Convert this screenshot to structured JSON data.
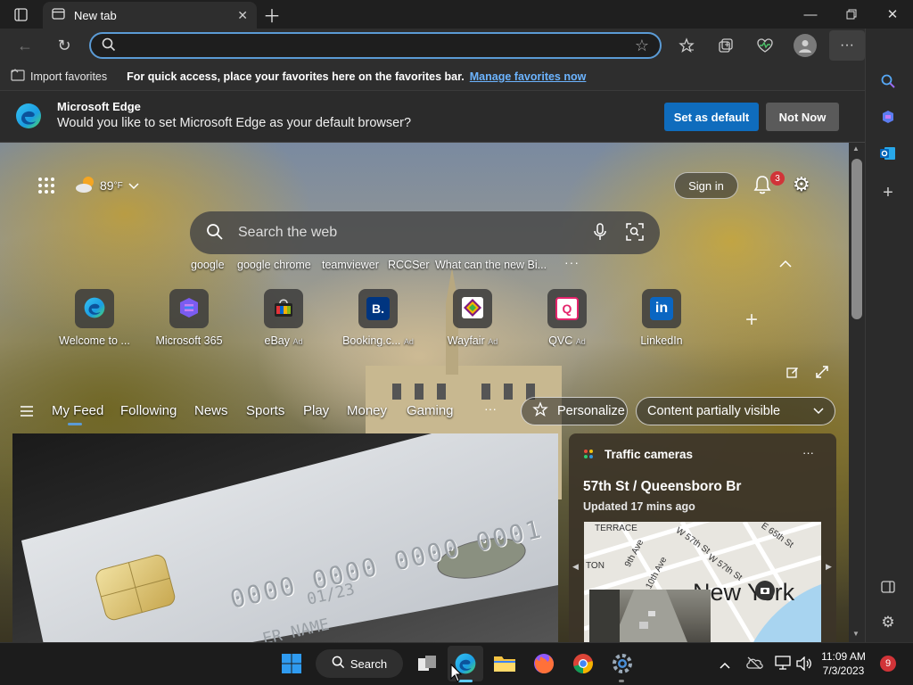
{
  "tab": {
    "title": "New tab"
  },
  "address": {
    "value": "",
    "placeholder": ""
  },
  "favorites_bar": {
    "import_label": "Import favorites",
    "hint": "For quick access, place your favorites here on the favorites bar.",
    "manage_link": "Manage favorites now"
  },
  "infobar": {
    "title": "Microsoft Edge",
    "message": "Would you like to set Microsoft Edge as your default browser?",
    "primary_button": "Set as default",
    "secondary_button": "Not Now"
  },
  "ntp": {
    "weather": "89",
    "weather_unit": "°F",
    "sign_in": "Sign in",
    "notification_count": "3",
    "search_placeholder": "Search the web",
    "suggestions": [
      "google",
      "google chrome",
      "teamviewer",
      "RCCSer",
      "What can the new Bi..."
    ],
    "quick_links": [
      {
        "label": "Welcome to ...",
        "ad": "",
        "icon": "edge-icon"
      },
      {
        "label": "Microsoft 365",
        "ad": "",
        "icon": "microsoft365-icon"
      },
      {
        "label": "eBay",
        "ad": "Ad",
        "icon": "ebay-icon"
      },
      {
        "label": "Booking.c...",
        "ad": "Ad",
        "icon": "booking-icon",
        "glyph": "B."
      },
      {
        "label": "Wayfair",
        "ad": "Ad",
        "icon": "wayfair-icon"
      },
      {
        "label": "QVC",
        "ad": "Ad",
        "icon": "qvc-icon",
        "glyph": "Q"
      },
      {
        "label": "LinkedIn",
        "ad": "",
        "icon": "linkedin-icon",
        "glyph": "in"
      }
    ],
    "feed_tabs": [
      "My Feed",
      "Following",
      "News",
      "Sports",
      "Play",
      "Money",
      "Gaming"
    ],
    "personalize": "Personalize",
    "content_visibility": "Content partially visible",
    "card_number": "0000 0000 0000 0001",
    "card_expiry": "01/23",
    "card_name": "ER NAME",
    "traffic": {
      "header": "Traffic cameras",
      "location": "57th St / Queensboro Br",
      "updated": "Updated 17 mins ago",
      "map_labels": [
        "TERRACE",
        "9th Ave",
        "W 57th St",
        "E 65th St",
        "TON",
        "10th Ave",
        "W 57th St",
        "New York"
      ]
    }
  },
  "taskbar": {
    "search_label": "Search",
    "time": "11:09 AM",
    "date": "7/3/2023",
    "notification_count": "9"
  },
  "colors": {
    "accent": "#0f6cbd",
    "link": "#6cb4ff",
    "focus_ring": "#5b9bd5"
  }
}
